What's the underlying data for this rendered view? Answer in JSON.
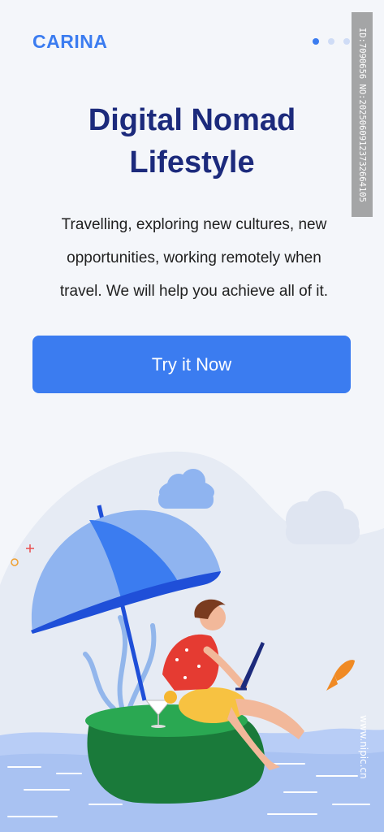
{
  "brand": {
    "logo_text": "CARINA"
  },
  "pagination": {
    "total": 3,
    "active_index": 0
  },
  "hero": {
    "title_line1": "Digital Nomad",
    "title_line2": "Lifestyle",
    "description_line1": "Travelling, exploring new cultures, new",
    "description_line2": "opportunities, working remotely when",
    "description_line3": "travel. We will help you achieve all of it."
  },
  "cta": {
    "label": "Try it Now"
  },
  "watermark": {
    "text": "ID:7090656 NO:20250609123732664105",
    "site": "www.nipic.cn"
  },
  "illustration": {
    "icons": [
      "cloud-icon",
      "umbrella-icon",
      "person-with-laptop-icon",
      "fish-icon",
      "sea-waves-icon",
      "island-icon",
      "cocktail-icon"
    ]
  },
  "colors": {
    "accent": "#3b7cf0",
    "title": "#1c2a7c",
    "background": "#f4f6fa"
  }
}
